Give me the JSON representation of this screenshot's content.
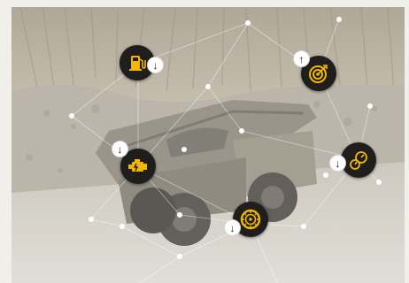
{
  "colors": {
    "hotspot_bg": "#1f1e1c",
    "hotspot_accent": "#f2b705",
    "badge_bg": "#ffffff",
    "network_lines": "#ffffff"
  },
  "hotspots": [
    {
      "name": "fuel",
      "icon": "fuel-pump-icon",
      "badge": "arrow-down"
    },
    {
      "name": "target",
      "icon": "target-icon",
      "badge": "arrow-up"
    },
    {
      "name": "engine",
      "icon": "engine-icon",
      "badge": "arrow-down"
    },
    {
      "name": "gauges",
      "icon": "gauge-icon",
      "badge": "arrow-down"
    },
    {
      "name": "tire",
      "icon": "tire-icon",
      "badge": "arrow-down"
    }
  ],
  "badge_glyphs": {
    "down": "↓",
    "up": "↑"
  }
}
